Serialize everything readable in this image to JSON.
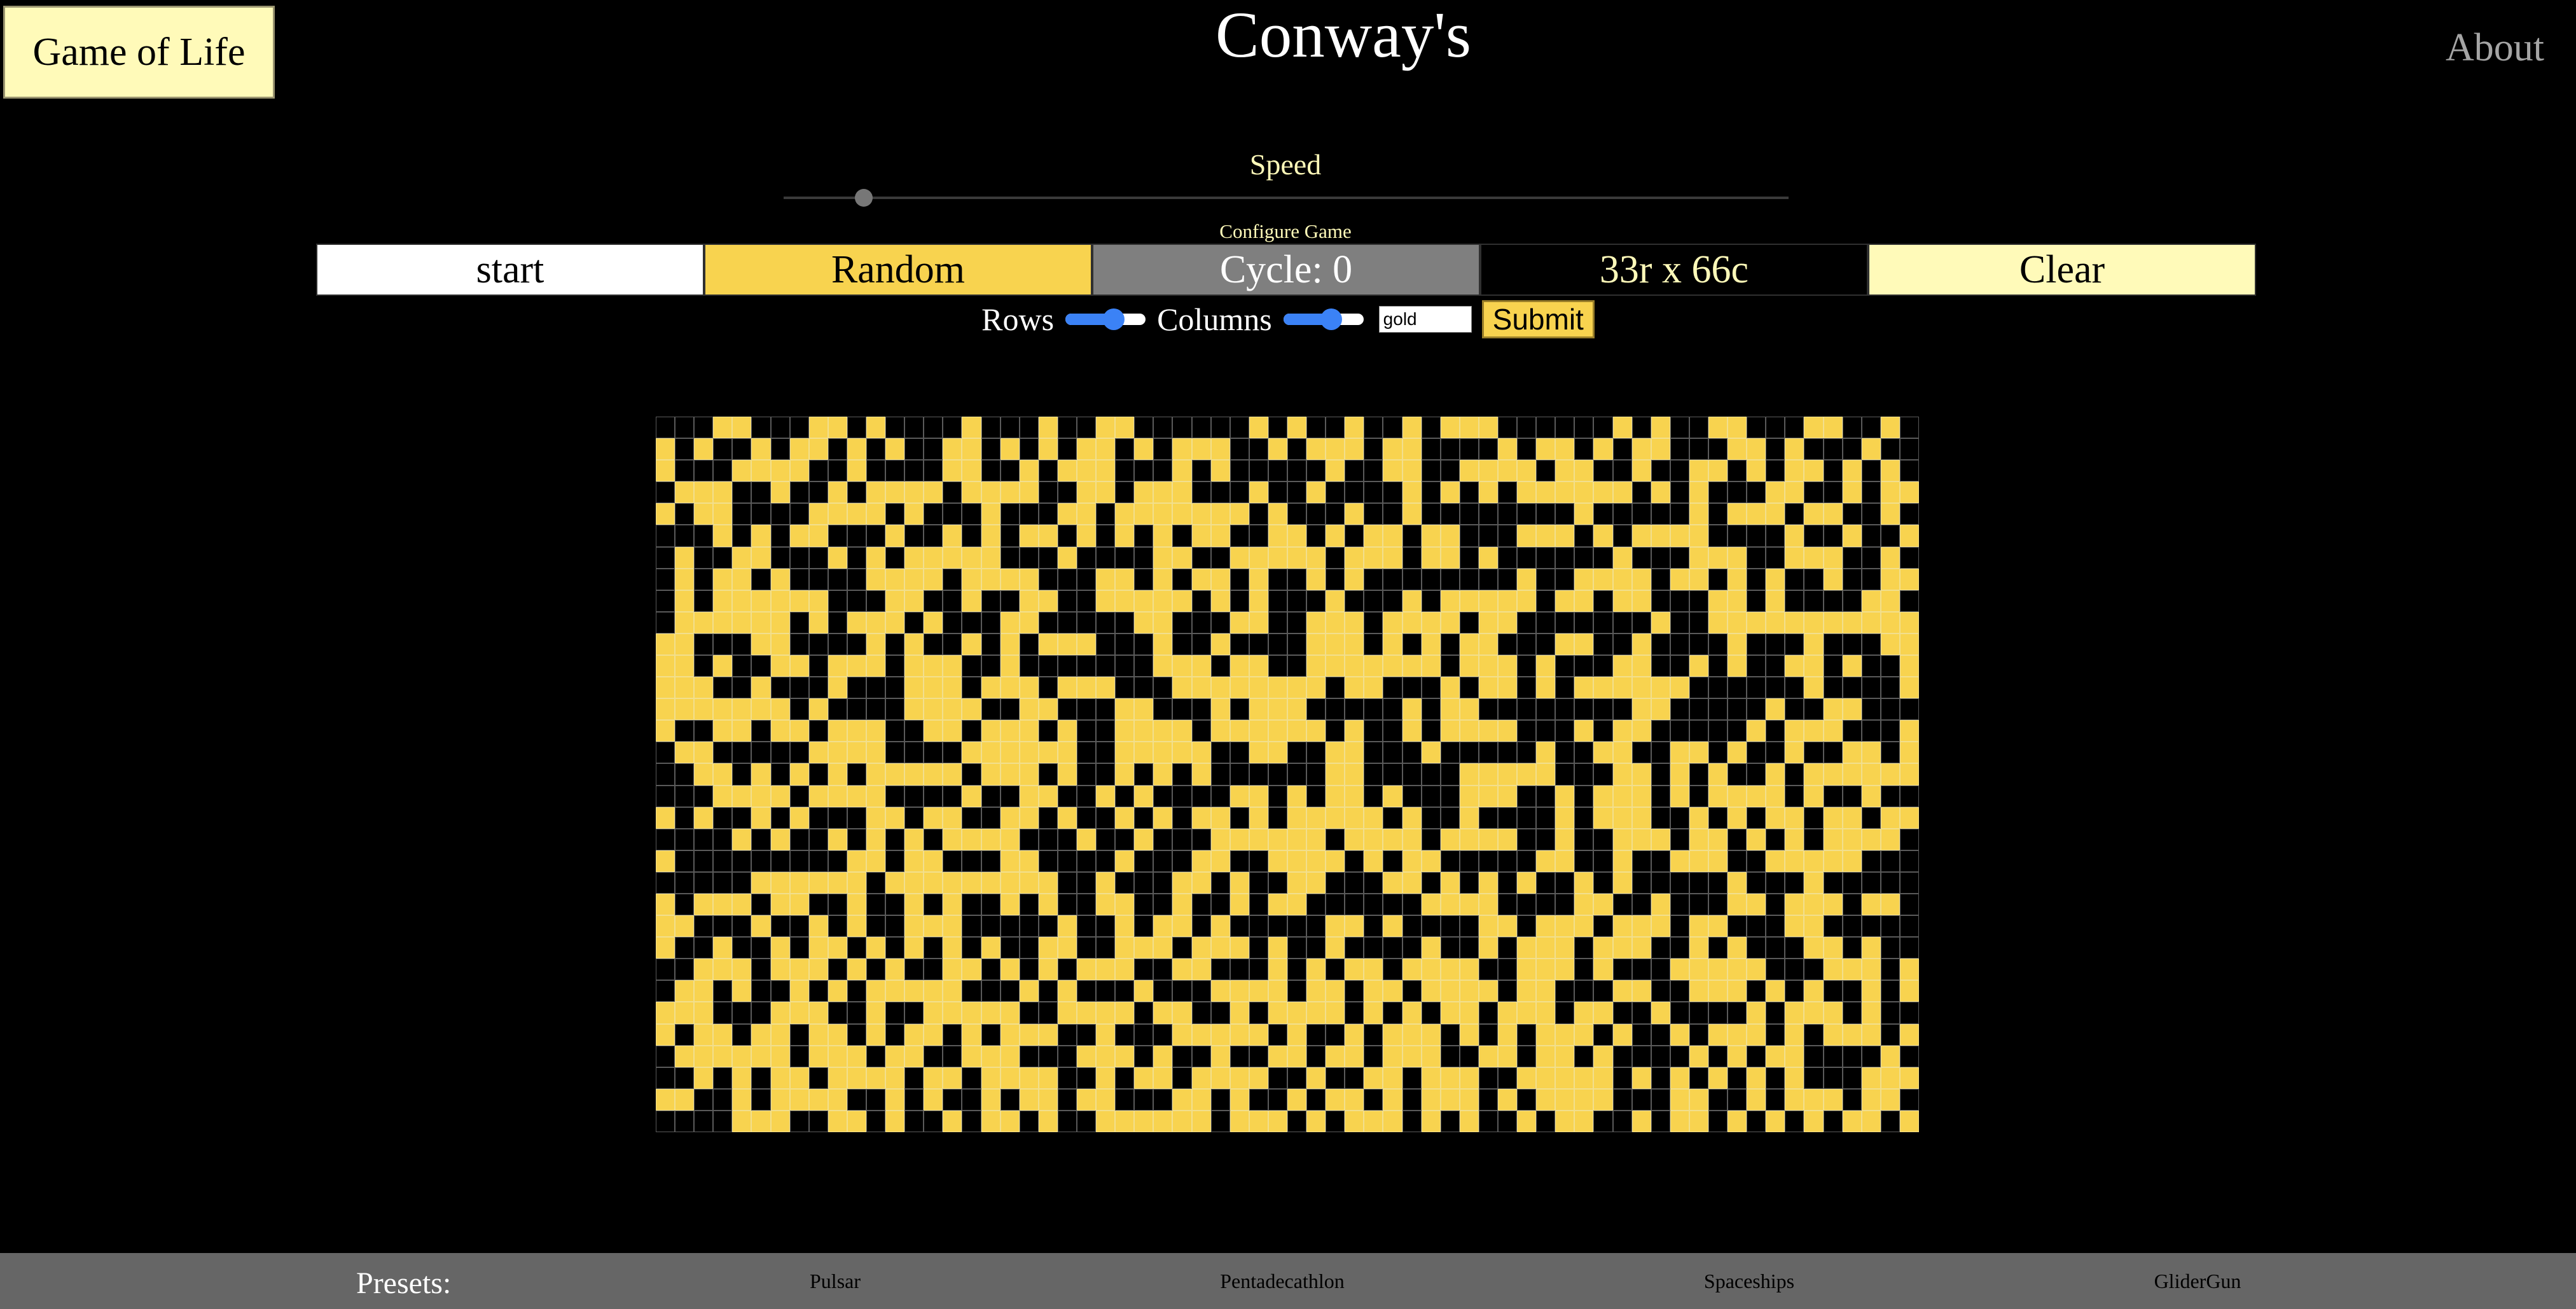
{
  "header": {
    "logo_label": "Game of Life",
    "title": "Conway's",
    "about_label": "About"
  },
  "speed": {
    "label": "Speed",
    "level_fraction": 0.08
  },
  "config": {
    "label": "Configure Game",
    "rows_label": "Rows",
    "rows_slider_fraction": 0.6,
    "columns_label": "Columns",
    "columns_slider_fraction": 0.6,
    "color_value": "gold",
    "submit_label": "Submit"
  },
  "controls": {
    "start_label": "start",
    "random_label": "Random",
    "cycle_text": "Cycle: 0",
    "dims_text": "33r x 66c",
    "clear_label": "Clear"
  },
  "grid": {
    "rows": 33,
    "cols": 66,
    "alive_color": "#f8d34f",
    "dead_color": "#000000",
    "cells": [
      "000110001101000010001001100000010100100101110000001010011000110010",
      "101001011010100110101011010111001011101100001011010110001101000100",
      "100011110010000110010111000101000001001100111101100100110101101010",
      "011100100101111011110011011100010010000101010111111010100011001011",
      "101100001111010001000110111111101000100100000000100000101110110010",
      "000101011000100101011010101011001101011011000111010111100001001001",
      "010011000101011111000100001100111110111011010000001000111001110010",
      "010110100001111011110001101011010010100000000100111101101010010011",
      "010111111000110010011001111101010001000101111101101100011010000110",
      "011111101011101000110000011000110011101111011000000010011111111111",
      "110001100001010010101110001001000011101010110001100100001000100011",
      "110100110111011100100000001110110011111110111010001100101001101001",
      "111001000100011101110111000111111110110001011010111111000000100001",
      "111111101000011110011000110001011100000101100000000110000010011000",
      "100110110111001101110100111101111110100101111000101100000101110001",
      "011000001111000011111100111110011001100010000010011001101001001101",
      "001101010101111101110100101010000001100000111110001101010010111111",
      "000111101111000010011001010000110101101000111001011101011110100100",
      "101001010001101100110100101011010111110100100001011100101011011011",
      "000010100101010111100010010001111110111101111001001110110101011110",
      "100000000011011000110000100011001111010110000011001001110011111000",
      "000001111110111111111001000110100110001101010100101000001000100000",
      "101110110010010100101001100100101100000011110000110010001101110110",
      "110001001010011100000100101101000001101000011011101110110001100000",
      "100100101101010101001100111011101001000010010111011100101000110100",
      "001110111010100110101011100110001010110111100111010001111100011101",
      "011010010101111100010100010001111011011011110110001100111010100101",
      "111000111001001111100111101100101111010101101110110010000101110100",
      "101101101101011010111001000111110100101110101011101001011101011101",
      "011111101110110011100011101001001101101110011011010000101011000010",
      "001010110111101101111001011011110010011011100111110101010101000111",
      "110010111100101001011011000110100101101011101011110001100101110110",
      "000011100110100101101001111110111010111010100101100101101010101101"
    ]
  },
  "footer": {
    "presets_label": "Presets:",
    "presets": [
      "Pulsar",
      "Pentadecathlon",
      "Spaceships",
      "GliderGun"
    ]
  }
}
